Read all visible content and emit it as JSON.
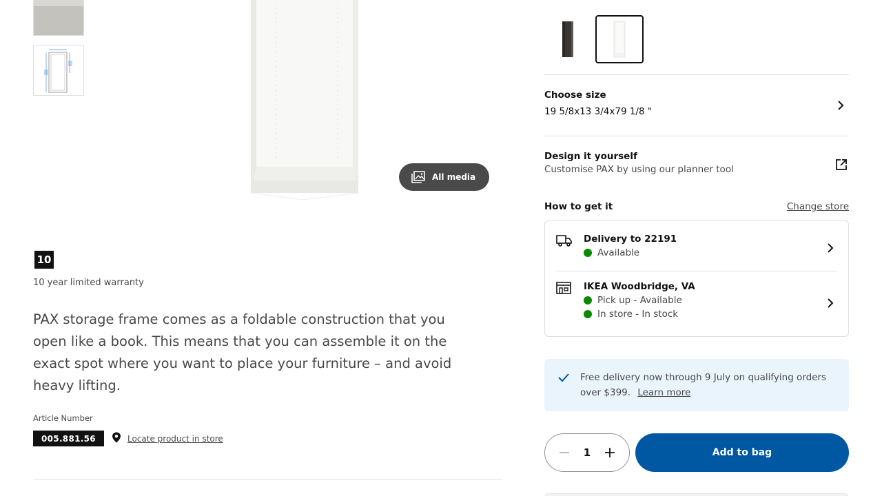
{
  "gallery": {
    "thumbnails": [
      "product-photo-thumbnail",
      "dimensions-drawing-thumbnail"
    ],
    "all_media_label": "All media"
  },
  "warranty": {
    "years_badge": "10",
    "text": "10 year limited warranty"
  },
  "description": "PAX storage frame comes as a foldable construction that you open like a book. This means that you can assemble it on the exact spot where you want to place your furniture – and avoid heavy lifting.",
  "article": {
    "label": "Article Number",
    "number": "005.881.56",
    "locate_link": "Locate product in store"
  },
  "color_swatches": [
    {
      "name": "dark-grey",
      "selected": false,
      "color": "#3a3634"
    },
    {
      "name": "white",
      "selected": true,
      "color": "#f3f3f0"
    }
  ],
  "size": {
    "title": "Choose size",
    "value": "19 5/8x13 3/4x79 1/8 \""
  },
  "design": {
    "title": "Design it yourself",
    "subtitle": "Customise PAX by using our planner tool"
  },
  "availability": {
    "title": "How to get it",
    "change_store": "Change store",
    "delivery": {
      "title": "Delivery to 22191",
      "status": "Available"
    },
    "store": {
      "title": "IKEA Woodbridge, VA",
      "pickup": "Pick up - Available",
      "instore": "In store - In stock"
    },
    "status_color": "#0a8a00"
  },
  "promo": {
    "text": "Free delivery now through 9 July on qualifying orders over $399.",
    "link": "Learn more"
  },
  "purchase": {
    "quantity": "1",
    "add_to_bag": "Add to bag",
    "accent": "#0058a3"
  }
}
